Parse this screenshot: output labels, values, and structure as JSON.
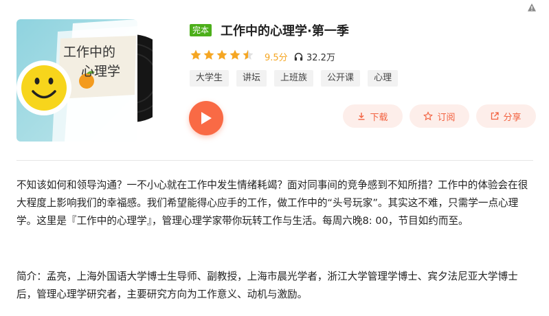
{
  "top_right": {
    "icon": "warning-icon"
  },
  "album": {
    "cover": {
      "line1": "工作中的",
      "line2": "心理学"
    },
    "status_badge": "完本",
    "title": "工作中的心理学·第一季",
    "rating": {
      "stars": 4.5,
      "score": "9.5分",
      "star_color": "#f5a623"
    },
    "plays": "32.2万",
    "tags": [
      "大学生",
      "讲坛",
      "上班族",
      "公开课",
      "心理"
    ]
  },
  "actions": {
    "download": "下载",
    "subscribe": "订阅",
    "share": "分享",
    "accent_color": "#f96a45"
  },
  "description": {
    "intro": "不知该如何和领导沟通？一不小心就在工作中发生情绪耗竭？面对同事间的竞争感到不知所措？工作中的体验会在很大程度上影响我们的幸福感。我们希望能得心应手的工作，做工作中的“头号玩家”。其实这不难，只需学一点心理学。这里是『工作中的心理学』，管理心理学家带你玩转工作与生活。每周六晚8: 00，节目如约而至。",
    "bio": "简介：孟亮，上海外国语大学博士生导师、副教授，上海市晨光学者，浙江大学管理学博士、宾夕法尼亚大学博士后，管理心理学研究者，主要研究方向为工作意义、动机与激励。"
  }
}
